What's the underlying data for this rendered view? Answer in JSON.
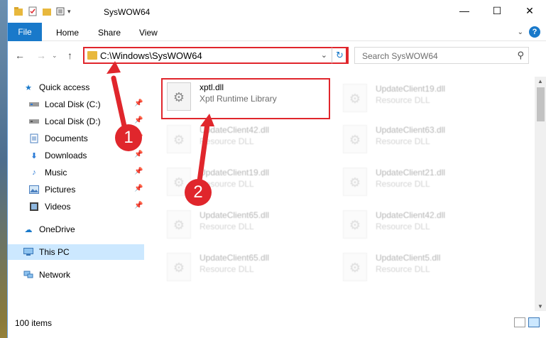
{
  "window": {
    "title": "SysWOW64",
    "controls": {
      "minimize": "—",
      "maximize": "☐",
      "close": "✕"
    }
  },
  "ribbon": {
    "tabs": [
      "File",
      "Home",
      "Share",
      "View"
    ],
    "help": "?"
  },
  "navbar": {
    "back": "←",
    "forward": "→",
    "up": "↑",
    "address_path": "C:\\Windows\\SysWOW64",
    "search_placeholder": "Search SysWOW64"
  },
  "sidebar": {
    "items": [
      {
        "label": "Quick access",
        "icon": "star-icon",
        "pinned": false
      },
      {
        "label": "Local Disk (C:)",
        "icon": "drive-icon",
        "pinned": true
      },
      {
        "label": "Local Disk (D:)",
        "icon": "drive-icon",
        "pinned": true
      },
      {
        "label": "Documents",
        "icon": "documents-icon",
        "pinned": true
      },
      {
        "label": "Downloads",
        "icon": "downloads-icon",
        "pinned": true
      },
      {
        "label": "Music",
        "icon": "music-icon",
        "pinned": true
      },
      {
        "label": "Pictures",
        "icon": "pictures-icon",
        "pinned": true
      },
      {
        "label": "Videos",
        "icon": "videos-icon",
        "pinned": true
      },
      {
        "label": "OneDrive",
        "icon": "cloud-icon",
        "pinned": false
      },
      {
        "label": "This PC",
        "icon": "computer-icon",
        "pinned": false,
        "selected": true
      },
      {
        "label": "Network",
        "icon": "network-icon",
        "pinned": false
      }
    ]
  },
  "files": [
    {
      "name": "xptl.dll",
      "type": "Xptl Runtime Library",
      "highlighted": true
    },
    {
      "name": "UpdateClient19.dll",
      "type": "Resource DLL"
    },
    {
      "name": "UpdateClient42.dll",
      "type": "Resource DLL"
    },
    {
      "name": "UpdateClient63.dll",
      "type": "Resource DLL"
    },
    {
      "name": "UpdateClient19.dll",
      "type": "Resource DLL"
    },
    {
      "name": "UpdateClient21.dll",
      "type": "Resource DLL"
    },
    {
      "name": "UpdateClient65.dll",
      "type": "Resource DLL"
    },
    {
      "name": "UpdateClient42.dll",
      "type": "Resource DLL"
    },
    {
      "name": "UpdateClient65.dll",
      "type": "Resource DLL"
    },
    {
      "name": "UpdateClient5.dll",
      "type": "Resource DLL"
    }
  ],
  "status": {
    "item_count": "100 items"
  },
  "annotations": {
    "step1": "1",
    "step2": "2",
    "color": "#e0262c"
  }
}
